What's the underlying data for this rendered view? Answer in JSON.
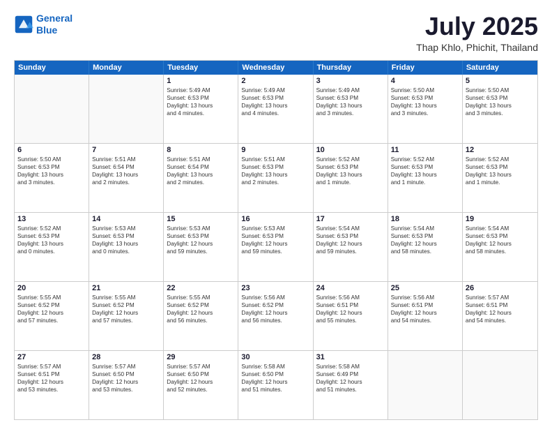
{
  "header": {
    "logo_line1": "General",
    "logo_line2": "Blue",
    "month_title": "July 2025",
    "location": "Thap Khlo, Phichit, Thailand"
  },
  "days_of_week": [
    "Sunday",
    "Monday",
    "Tuesday",
    "Wednesday",
    "Thursday",
    "Friday",
    "Saturday"
  ],
  "rows": [
    [
      {
        "day": "",
        "lines": [],
        "empty": true
      },
      {
        "day": "",
        "lines": [],
        "empty": true
      },
      {
        "day": "1",
        "lines": [
          "Sunrise: 5:49 AM",
          "Sunset: 6:53 PM",
          "Daylight: 13 hours",
          "and 4 minutes."
        ]
      },
      {
        "day": "2",
        "lines": [
          "Sunrise: 5:49 AM",
          "Sunset: 6:53 PM",
          "Daylight: 13 hours",
          "and 4 minutes."
        ]
      },
      {
        "day": "3",
        "lines": [
          "Sunrise: 5:49 AM",
          "Sunset: 6:53 PM",
          "Daylight: 13 hours",
          "and 3 minutes."
        ]
      },
      {
        "day": "4",
        "lines": [
          "Sunrise: 5:50 AM",
          "Sunset: 6:53 PM",
          "Daylight: 13 hours",
          "and 3 minutes."
        ]
      },
      {
        "day": "5",
        "lines": [
          "Sunrise: 5:50 AM",
          "Sunset: 6:53 PM",
          "Daylight: 13 hours",
          "and 3 minutes."
        ]
      }
    ],
    [
      {
        "day": "6",
        "lines": [
          "Sunrise: 5:50 AM",
          "Sunset: 6:53 PM",
          "Daylight: 13 hours",
          "and 3 minutes."
        ]
      },
      {
        "day": "7",
        "lines": [
          "Sunrise: 5:51 AM",
          "Sunset: 6:54 PM",
          "Daylight: 13 hours",
          "and 2 minutes."
        ]
      },
      {
        "day": "8",
        "lines": [
          "Sunrise: 5:51 AM",
          "Sunset: 6:54 PM",
          "Daylight: 13 hours",
          "and 2 minutes."
        ]
      },
      {
        "day": "9",
        "lines": [
          "Sunrise: 5:51 AM",
          "Sunset: 6:53 PM",
          "Daylight: 13 hours",
          "and 2 minutes."
        ]
      },
      {
        "day": "10",
        "lines": [
          "Sunrise: 5:52 AM",
          "Sunset: 6:53 PM",
          "Daylight: 13 hours",
          "and 1 minute."
        ]
      },
      {
        "day": "11",
        "lines": [
          "Sunrise: 5:52 AM",
          "Sunset: 6:53 PM",
          "Daylight: 13 hours",
          "and 1 minute."
        ]
      },
      {
        "day": "12",
        "lines": [
          "Sunrise: 5:52 AM",
          "Sunset: 6:53 PM",
          "Daylight: 13 hours",
          "and 1 minute."
        ]
      }
    ],
    [
      {
        "day": "13",
        "lines": [
          "Sunrise: 5:52 AM",
          "Sunset: 6:53 PM",
          "Daylight: 13 hours",
          "and 0 minutes."
        ]
      },
      {
        "day": "14",
        "lines": [
          "Sunrise: 5:53 AM",
          "Sunset: 6:53 PM",
          "Daylight: 13 hours",
          "and 0 minutes."
        ]
      },
      {
        "day": "15",
        "lines": [
          "Sunrise: 5:53 AM",
          "Sunset: 6:53 PM",
          "Daylight: 12 hours",
          "and 59 minutes."
        ]
      },
      {
        "day": "16",
        "lines": [
          "Sunrise: 5:53 AM",
          "Sunset: 6:53 PM",
          "Daylight: 12 hours",
          "and 59 minutes."
        ]
      },
      {
        "day": "17",
        "lines": [
          "Sunrise: 5:54 AM",
          "Sunset: 6:53 PM",
          "Daylight: 12 hours",
          "and 59 minutes."
        ]
      },
      {
        "day": "18",
        "lines": [
          "Sunrise: 5:54 AM",
          "Sunset: 6:53 PM",
          "Daylight: 12 hours",
          "and 58 minutes."
        ]
      },
      {
        "day": "19",
        "lines": [
          "Sunrise: 5:54 AM",
          "Sunset: 6:53 PM",
          "Daylight: 12 hours",
          "and 58 minutes."
        ]
      }
    ],
    [
      {
        "day": "20",
        "lines": [
          "Sunrise: 5:55 AM",
          "Sunset: 6:52 PM",
          "Daylight: 12 hours",
          "and 57 minutes."
        ]
      },
      {
        "day": "21",
        "lines": [
          "Sunrise: 5:55 AM",
          "Sunset: 6:52 PM",
          "Daylight: 12 hours",
          "and 57 minutes."
        ]
      },
      {
        "day": "22",
        "lines": [
          "Sunrise: 5:55 AM",
          "Sunset: 6:52 PM",
          "Daylight: 12 hours",
          "and 56 minutes."
        ]
      },
      {
        "day": "23",
        "lines": [
          "Sunrise: 5:56 AM",
          "Sunset: 6:52 PM",
          "Daylight: 12 hours",
          "and 56 minutes."
        ]
      },
      {
        "day": "24",
        "lines": [
          "Sunrise: 5:56 AM",
          "Sunset: 6:51 PM",
          "Daylight: 12 hours",
          "and 55 minutes."
        ]
      },
      {
        "day": "25",
        "lines": [
          "Sunrise: 5:56 AM",
          "Sunset: 6:51 PM",
          "Daylight: 12 hours",
          "and 54 minutes."
        ]
      },
      {
        "day": "26",
        "lines": [
          "Sunrise: 5:57 AM",
          "Sunset: 6:51 PM",
          "Daylight: 12 hours",
          "and 54 minutes."
        ]
      }
    ],
    [
      {
        "day": "27",
        "lines": [
          "Sunrise: 5:57 AM",
          "Sunset: 6:51 PM",
          "Daylight: 12 hours",
          "and 53 minutes."
        ]
      },
      {
        "day": "28",
        "lines": [
          "Sunrise: 5:57 AM",
          "Sunset: 6:50 PM",
          "Daylight: 12 hours",
          "and 53 minutes."
        ]
      },
      {
        "day": "29",
        "lines": [
          "Sunrise: 5:57 AM",
          "Sunset: 6:50 PM",
          "Daylight: 12 hours",
          "and 52 minutes."
        ]
      },
      {
        "day": "30",
        "lines": [
          "Sunrise: 5:58 AM",
          "Sunset: 6:50 PM",
          "Daylight: 12 hours",
          "and 51 minutes."
        ]
      },
      {
        "day": "31",
        "lines": [
          "Sunrise: 5:58 AM",
          "Sunset: 6:49 PM",
          "Daylight: 12 hours",
          "and 51 minutes."
        ]
      },
      {
        "day": "",
        "lines": [],
        "empty": true
      },
      {
        "day": "",
        "lines": [],
        "empty": true
      }
    ]
  ]
}
